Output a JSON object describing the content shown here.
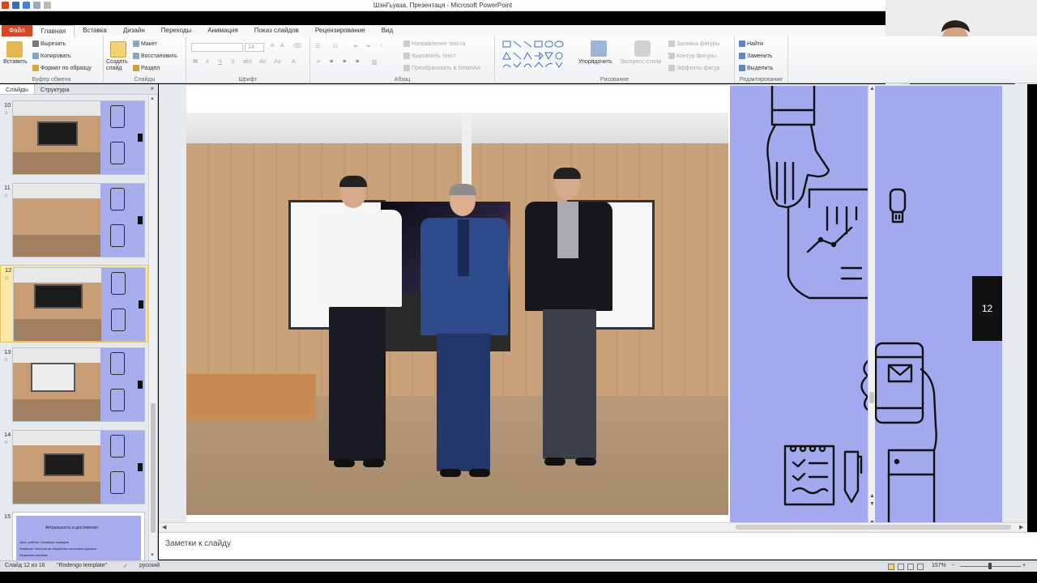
{
  "window": {
    "title": "ШэнГьуаза. Презентаця - Microsoft PowerPoint"
  },
  "menu": {
    "file": "Файл",
    "tabs": [
      "Главная",
      "Вставка",
      "Дизайн",
      "Переходы",
      "Анимация",
      "Показ слайдов",
      "Рецензирование",
      "Вид"
    ]
  },
  "ribbon": {
    "clipboard": {
      "paste": "Вставить",
      "cut": "Вырезать",
      "copy": "Копировать",
      "format_painter": "Формат по образцу",
      "label": "Буфер обмена"
    },
    "slides": {
      "new_slide": "Создать слайд",
      "layout": "Макет",
      "reset": "Восстановить",
      "section": "Раздел",
      "label": "Слайды"
    },
    "font": {
      "size": "24",
      "bold": "Ж",
      "italic": "К",
      "underline": "Ч",
      "label": "Шрифт"
    },
    "paragraph": {
      "text_direction": "Направление текста",
      "align_text": "Выровнять текст",
      "smartart": "Преобразовать в SmartArt",
      "label": "Абзац"
    },
    "drawing": {
      "arrange": "Упорядочить",
      "quick_styles": "Экспресс-стили",
      "shape_fill": "Заливка фигуры",
      "shape_outline": "Контур фигуры",
      "shape_effects": "Эффекты фигур",
      "label": "Рисование"
    },
    "editing": {
      "find": "Найти",
      "replace": "Заменить",
      "select": "Выделить",
      "label": "Редактирование"
    }
  },
  "left_panel": {
    "tabs": [
      "Слайды",
      "Структура"
    ],
    "close": "×",
    "thumbnails": [
      {
        "num": "10"
      },
      {
        "num": "11"
      },
      {
        "num": "12"
      },
      {
        "num": "13"
      },
      {
        "num": "14"
      },
      {
        "num": "15"
      }
    ],
    "slide15_title": "Актуальность и достижения",
    "slide15_lines": [
      "Цель работы: проверка выводов",
      "Развитие технологии обработки потоковых данных",
      "Реальная система: ..."
    ]
  },
  "slide": {
    "number": "12"
  },
  "notes": {
    "placeholder": "Заметки к слайду"
  },
  "status": {
    "slide_info": "Слайд 12 из 16",
    "theme": "\"Rodengo template\"",
    "language": "русский",
    "zoom": "157%"
  },
  "colors": {
    "accent_blue": "#a3a9ef",
    "file_tab": "#d24726",
    "selected_thumb": "#fbe7a7"
  }
}
